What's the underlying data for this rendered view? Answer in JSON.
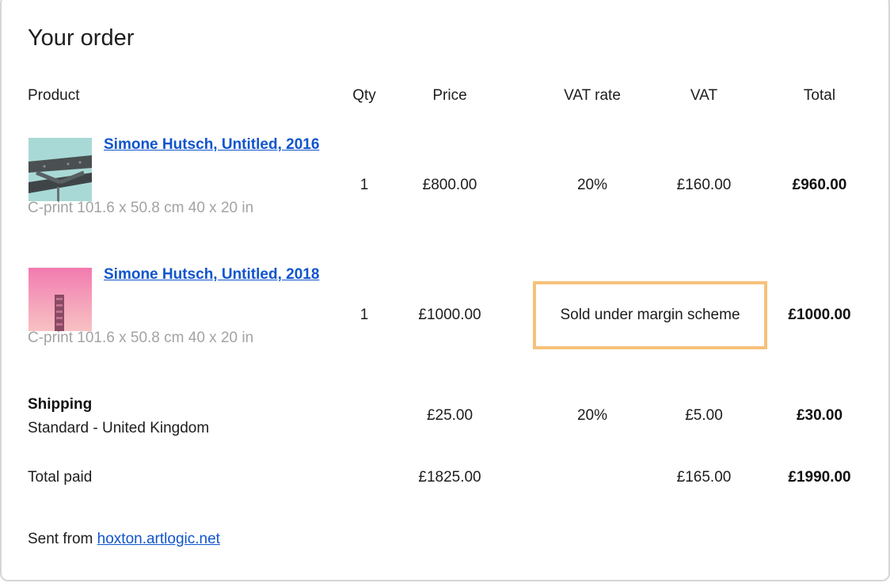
{
  "order": {
    "title": "Your order",
    "headers": {
      "product": "Product",
      "qty": "Qty",
      "price": "Price",
      "vat_rate": "VAT rate",
      "vat": "VAT",
      "total": "Total"
    },
    "items": [
      {
        "name": "Simone Hutsch, Untitled, 2016",
        "details": "C-print 101.6 x 50.8 cm 40 x 20 in",
        "qty": "1",
        "price": "£800.00",
        "vat_rate": "20%",
        "vat": "£160.00",
        "total": "£960.00"
      },
      {
        "name": "Simone Hutsch, Untitled, 2018",
        "details": "C-print 101.6 x 50.8 cm 40 x 20 in",
        "qty": "1",
        "price": "£1000.00",
        "vat_note": "Sold under margin scheme",
        "total": "£1000.00"
      }
    ],
    "shipping": {
      "label": "Shipping",
      "method": "Standard - United Kingdom",
      "price": "£25.00",
      "vat_rate": "20%",
      "vat": "£5.00",
      "total": "£30.00"
    },
    "totals": {
      "label": "Total paid",
      "price": "£1825.00",
      "vat": "£165.00",
      "total": "£1990.00"
    },
    "footer": {
      "prefix": "Sent from ",
      "link": "hoxton.artlogic.net"
    }
  },
  "colors": {
    "link": "#1155cc",
    "muted": "#a3a3a3",
    "highlight_border": "#f7c17a",
    "card_border": "#d6d6d6"
  }
}
